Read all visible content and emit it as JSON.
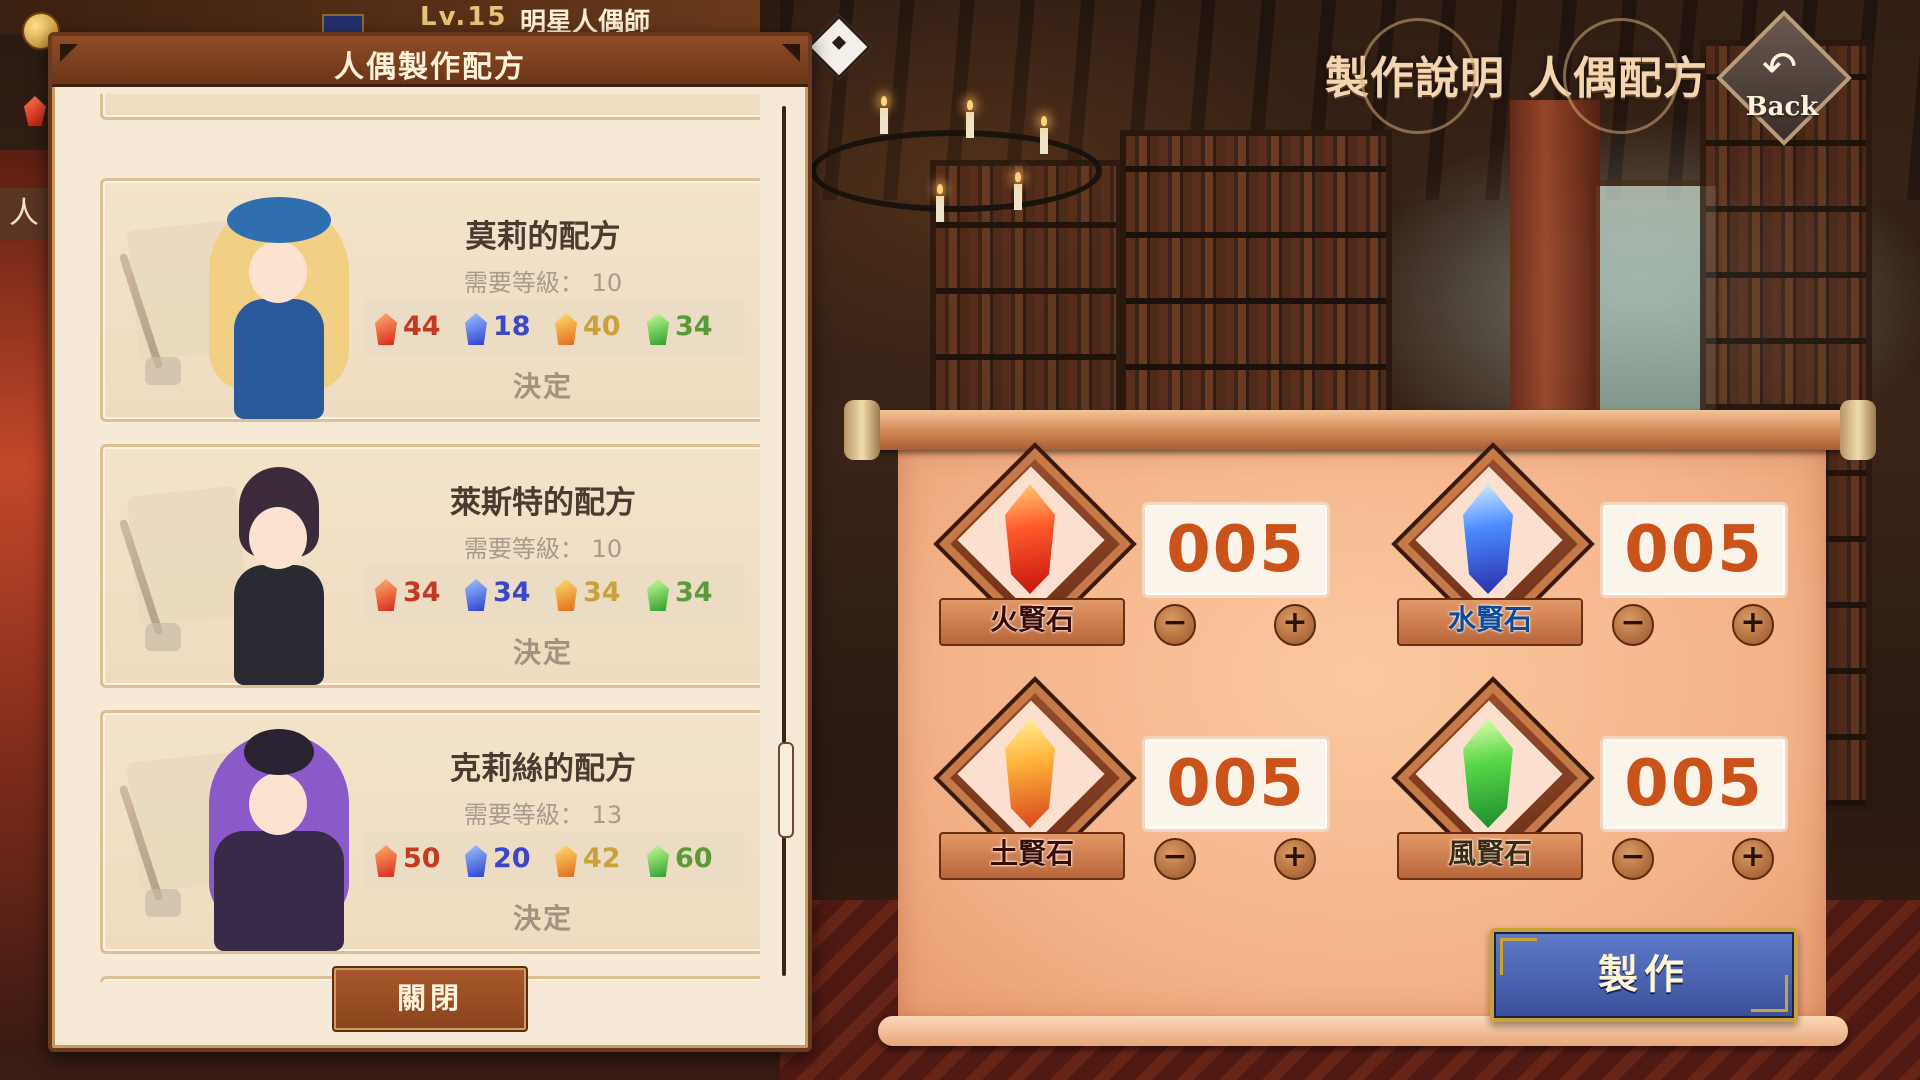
{
  "topbar": {
    "level": "Lv.15",
    "player_name": "明星人偶師"
  },
  "side_stub_char": "人",
  "panel": {
    "title": "人偶製作配方",
    "close_label": "關閉",
    "recipes": [
      {
        "name": "莫莉的配方",
        "level_label": "需要等級：",
        "level": "10",
        "costs": {
          "fire": "44",
          "water": "18",
          "earth": "40",
          "wind": "34"
        },
        "decide_label": "決定",
        "colors": {
          "hair": "#f1cf85",
          "outfit": "#2b5a9a",
          "hat": "#2f6fb0"
        }
      },
      {
        "name": "萊斯特的配方",
        "level_label": "需要等級：",
        "level": "10",
        "costs": {
          "fire": "34",
          "water": "34",
          "earth": "34",
          "wind": "34"
        },
        "decide_label": "決定",
        "colors": {
          "hair": "#3a2a3a",
          "outfit": "#2a2a32",
          "hat": "#3a2a3a"
        }
      },
      {
        "name": "克莉絲的配方",
        "level_label": "需要等級：",
        "level": "13",
        "costs": {
          "fire": "50",
          "water": "20",
          "earth": "42",
          "wind": "60"
        },
        "decide_label": "決定",
        "colors": {
          "hair": "#8a5ac8",
          "outfit": "#3a2a4a",
          "hat": "#2a2230"
        }
      }
    ]
  },
  "nav": {
    "instructions_label": "製作說明",
    "recipes_label": "人偶配方",
    "back_label": "Back"
  },
  "crafting": {
    "stones": [
      {
        "key": "fire",
        "label": "火賢石",
        "quantity": "005"
      },
      {
        "key": "water",
        "label": "水賢石",
        "quantity": "005"
      },
      {
        "key": "earth",
        "label": "土賢石",
        "quantity": "005"
      },
      {
        "key": "wind",
        "label": "風賢石",
        "quantity": "005"
      }
    ],
    "craft_label": "製作"
  },
  "icons": {
    "fire": "fire-gem-icon",
    "water": "water-gem-icon",
    "earth": "earth-gem-icon",
    "wind": "wind-gem-icon",
    "minus": "minus-icon",
    "plus": "plus-icon",
    "back": "back-arrow-icon"
  },
  "accent_colors": {
    "quantity_text": "#c9531a",
    "craft_button": "#3a4f9a",
    "panel_header": "#7a3f1f"
  }
}
